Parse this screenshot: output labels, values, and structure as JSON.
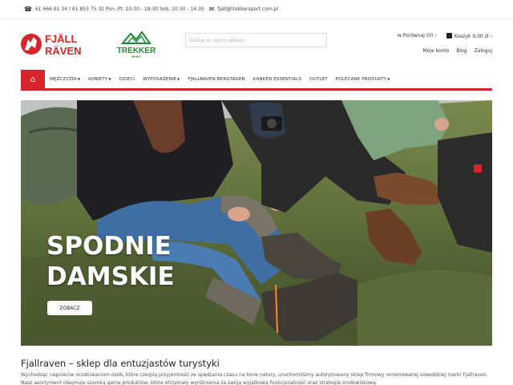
{
  "topbar": {
    "phone_icon": "phone-icon",
    "phone_text": "61 666 61 34 / 61 853 75 32 Pon.-Pt. 10:30 - 18:30 Sob. 10:30 - 14:30",
    "mail_icon": "envelope-icon",
    "email": "fjall@trekkersport.com.pl"
  },
  "header": {
    "logo_fjallraven_line1": "FJÄLL",
    "logo_fjallraven_line2": "RÄVEN",
    "logo_trekker": "TREKKER",
    "logo_trekker_sub": "SPORT",
    "search_placeholder": "Szukaj w całym sklepie",
    "compare_label": "Porównaj (0)",
    "cart_label": "Koszyk 0,00 zł",
    "account_link": "Moje konto",
    "blog_link": "Blog",
    "login_link": "Zaloguj"
  },
  "nav": {
    "home_icon": "home-icon",
    "items": [
      {
        "label": "MĘŻCZYŹNI",
        "dropdown": true
      },
      {
        "label": "KOBIETY",
        "dropdown": true
      },
      {
        "label": "DZIECI",
        "dropdown": false
      },
      {
        "label": "WYPOSAŻENIE",
        "dropdown": true
      },
      {
        "label": "FJALLRAVEN BERGTAGEN",
        "dropdown": false
      },
      {
        "label": "KANKEN ESSENTIALS",
        "dropdown": false
      },
      {
        "label": "OUTLET",
        "dropdown": false
      },
      {
        "label": "POLECANE PRODUKTY",
        "dropdown": true
      }
    ]
  },
  "hero": {
    "title_line1": "SPODNIE",
    "title_line2": "DAMSKIE",
    "button_label": "ZOBACZ"
  },
  "intro": {
    "title": "Fjallraven – sklep dla entuzjastów turystyki",
    "text": "Wychodząc naprzeciw oczekiwaniom osób, które czerpią przyjemność ze spędzania czasu na łonie natury, uruchomiliśmy autoryzowany sklep firmowy renomowanej szwedzkiej marki Fjallraven. Nasz asortyment obejmuje szeroką gamę produktów, które otrzymały wyróżnienia za swoją wyjątkową funkcjonalność oraz strategię środowiskową."
  },
  "colors": {
    "brand_red": "#d9232a",
    "trekker_green": "#1f8a3a"
  }
}
